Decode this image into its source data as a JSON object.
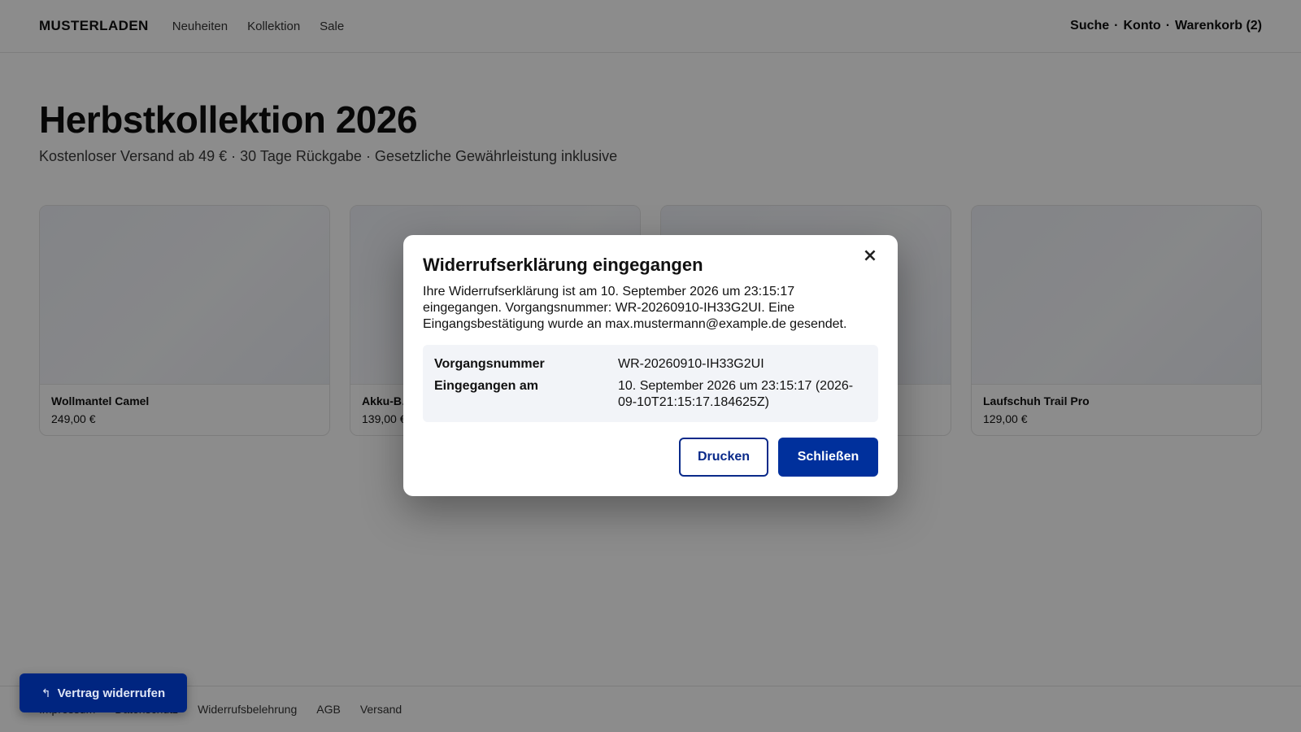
{
  "header": {
    "logo": "MUSTERLADEN",
    "nav": [
      "Neuheiten",
      "Kollektion",
      "Sale"
    ],
    "actions": [
      "Suche",
      "Konto",
      "Warenkorb (2)"
    ],
    "separator": "·"
  },
  "hero": {
    "title": "Herbstkollektion 2026",
    "subtitle": "Kostenloser Versand ab 49 € · 30 Tage Rückgabe · Gesetzliche Gewährleistung inklusive"
  },
  "products": [
    {
      "name": "Wollmantel Camel",
      "price": "249,00 €"
    },
    {
      "name": "Akku-B…",
      "price": "139,00 €"
    },
    {
      "name": "",
      "price": ""
    },
    {
      "name": "Laufschuh Trail Pro",
      "price": "129,00 €"
    }
  ],
  "footer": {
    "links": [
      "Impressum",
      "Datenschutz",
      "Widerrufsbelehrung",
      "AGB",
      "Versand"
    ]
  },
  "withdraw_button": {
    "icon": "↰",
    "label": "Vertrag widerrufen"
  },
  "modal": {
    "title": "Widerrufserklärung eingegangen",
    "close_icon": "×",
    "text": "Ihre Widerrufserklärung ist am 10. September 2026 um 23:15:17 eingegangen. Vorgangsnummer: WR-20260910-IH33G2UI. Eine Eingangsbestätigung wurde an max.mustermann@example.de gesendet.",
    "details": [
      {
        "label": "Vorgangsnummer",
        "value": "WR-20260910-IH33G2UI"
      },
      {
        "label": "Eingegangen am",
        "value": "10. September 2026 um 23:15:17 (2026-09-10T21:15:17.184625Z)"
      }
    ],
    "print_label": "Drucken",
    "close_label": "Schließen"
  },
  "colors": {
    "overlay": "rgba(0,0,0,0.45)",
    "primary": "#00309c",
    "floating_button": "#002580",
    "details_bg": "#f2f4f8"
  }
}
